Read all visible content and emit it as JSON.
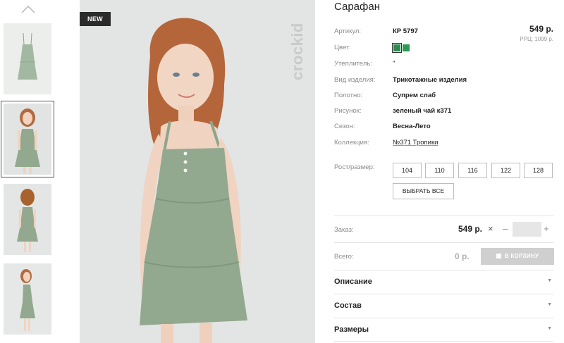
{
  "gallery": {
    "badge": "NEW",
    "brand": "crockid"
  },
  "product": {
    "title": "Сарафан",
    "price": "549 р.",
    "rrp": "РРЦ: 1099 р.",
    "attributes": {
      "article": {
        "label": "Артикул:",
        "value": "КР 5797"
      },
      "color": {
        "label": "Цвет:"
      },
      "insulation": {
        "label": "Утеплитель:",
        "value": "\""
      },
      "type": {
        "label": "Вид изделия:",
        "value": "Трикотажные изделия"
      },
      "fabric": {
        "label": "Полотно:",
        "value": "Супрем слаб"
      },
      "pattern": {
        "label": "Рисунок:",
        "value": "зеленый чай к371"
      },
      "season": {
        "label": "Сезон:",
        "value": "Весна-Лето"
      },
      "collection": {
        "label": "Коллекция:",
        "value": "№371 Тропики"
      }
    },
    "colors": [
      "#2e8b4f",
      "#2e9a55"
    ],
    "sizes": {
      "label": "Рост/размер:",
      "options": [
        "104",
        "110",
        "116",
        "122",
        "128"
      ],
      "select_all": "ВЫБРАТЬ ВСЕ"
    }
  },
  "order": {
    "label": "Заказ:",
    "price": "549 р.",
    "times": "×",
    "minus": "–",
    "plus": "+",
    "quantity": ""
  },
  "total": {
    "label": "Всего:",
    "value": "0 р.",
    "cart_button": "В КОРЗИНУ"
  },
  "accordion": [
    {
      "label": "Описание"
    },
    {
      "label": "Состав"
    },
    {
      "label": "Размеры"
    }
  ]
}
